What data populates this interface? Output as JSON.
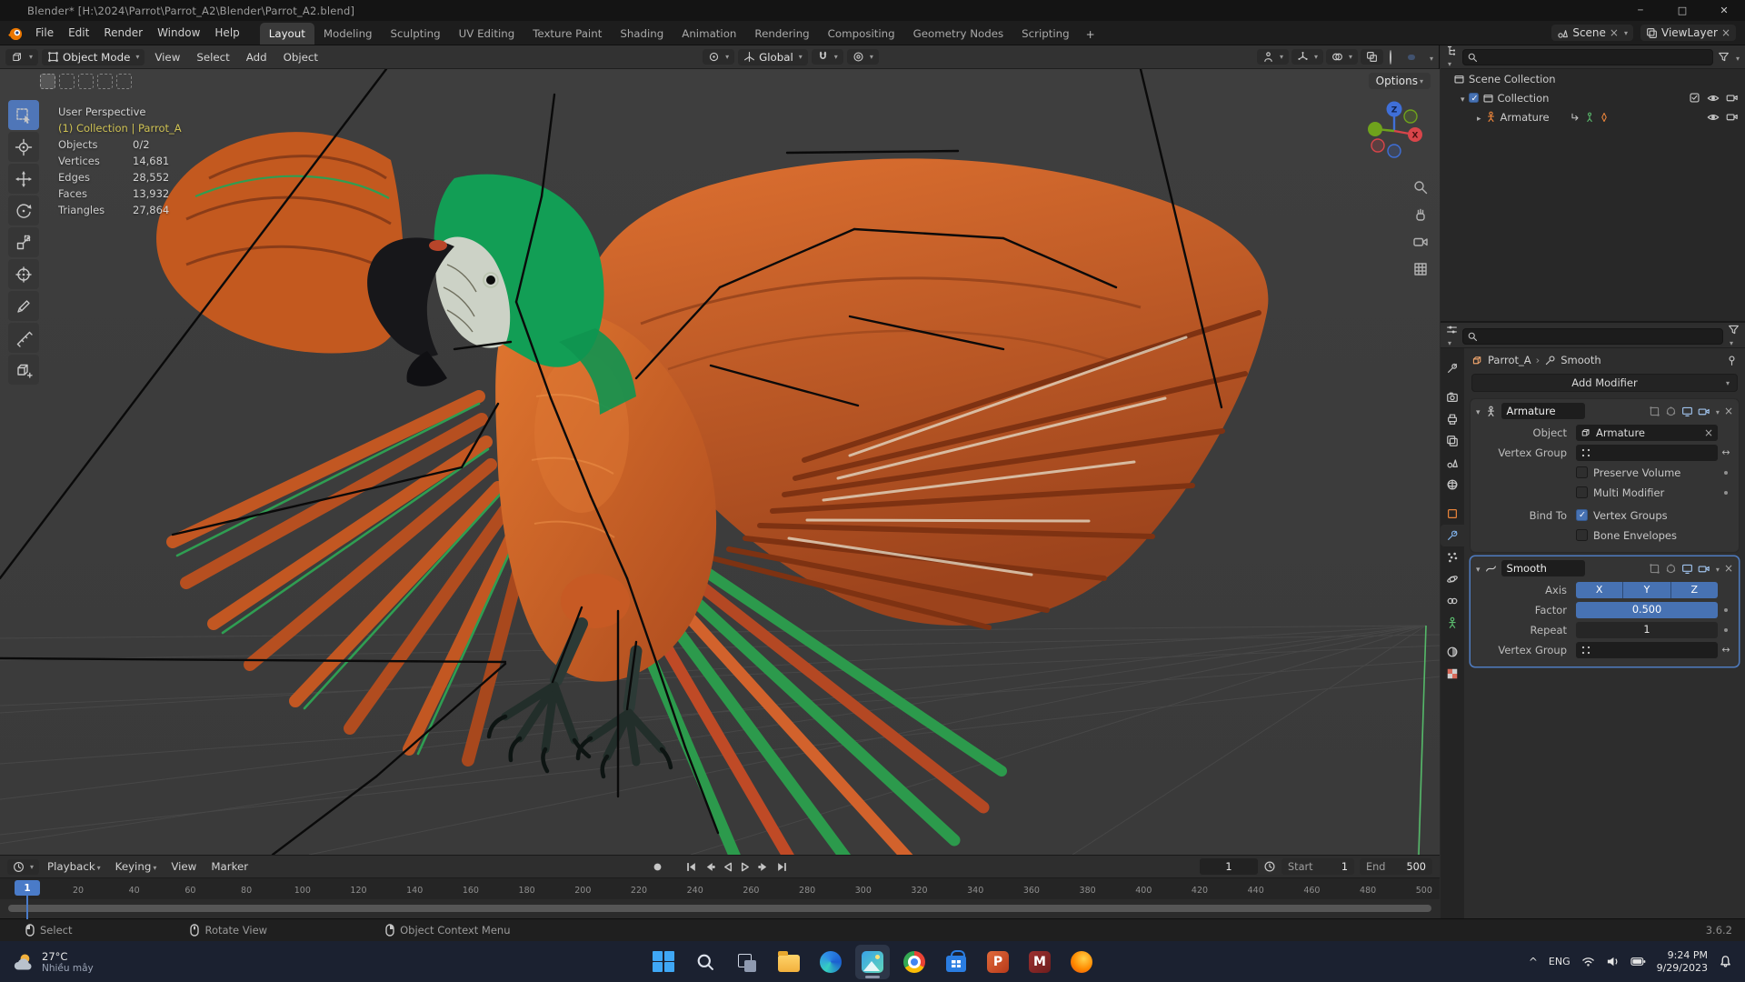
{
  "window": {
    "title": "Blender* [H:\\2024\\Parrot\\Parrot_A2\\Blender\\Parrot_A2.blend]"
  },
  "topbar": {
    "menus": {
      "file": "File",
      "edit": "Edit",
      "render": "Render",
      "window": "Window",
      "help": "Help"
    },
    "workspaces": [
      "Layout",
      "Modeling",
      "Sculpting",
      "UV Editing",
      "Texture Paint",
      "Shading",
      "Animation",
      "Rendering",
      "Compositing",
      "Geometry Nodes",
      "Scripting"
    ],
    "add_workspace_label": "+",
    "scene_name": "Scene",
    "view_layer_name": "ViewLayer"
  },
  "viewport": {
    "header": {
      "mode": "Object Mode",
      "view": "View",
      "select": "Select",
      "add": "Add",
      "object": "Object",
      "orientation": "Global"
    },
    "options_label": "Options",
    "overlay": {
      "perspective": "User Perspective",
      "context": "(1) Collection | Parrot_A",
      "stats": [
        {
          "label": "Objects",
          "value": "0/2"
        },
        {
          "label": "Vertices",
          "value": "14,681"
        },
        {
          "label": "Edges",
          "value": "28,552"
        },
        {
          "label": "Faces",
          "value": "13,932"
        },
        {
          "label": "Triangles",
          "value": "27,864"
        }
      ]
    }
  },
  "outliner": {
    "rows": [
      {
        "label": "Scene Collection"
      },
      {
        "label": "Collection"
      },
      {
        "label": "Armature"
      }
    ]
  },
  "properties": {
    "breadcrumb": {
      "object": "Parrot_A",
      "modifier": "Smooth"
    },
    "add_modifier_label": "Add Modifier",
    "armature": {
      "name": "Armature",
      "object_label": "Object",
      "object_value": "Armature",
      "vertex_group_label": "Vertex Group",
      "preserve_volume_label": "Preserve Volume",
      "multi_modifier_label": "Multi Modifier",
      "bind_to_label": "Bind To",
      "vertex_groups_label": "Vertex Groups",
      "bone_envelopes_label": "Bone Envelopes"
    },
    "smooth": {
      "name": "Smooth",
      "axis_label": "Axis",
      "axis_x": "X",
      "axis_y": "Y",
      "axis_z": "Z",
      "factor_label": "Factor",
      "factor_value": "0.500",
      "repeat_label": "Repeat",
      "repeat_value": "1",
      "vertex_group_label": "Vertex Group"
    }
  },
  "timeline": {
    "menus": {
      "playback": "Playback",
      "keying": "Keying",
      "view": "View",
      "marker": "Marker"
    },
    "current_frame": "1",
    "start_label": "Start",
    "start_value": "1",
    "end_label": "End",
    "end_value": "500",
    "ruler_marks": [
      20,
      40,
      60,
      80,
      100,
      120,
      140,
      160,
      180,
      200,
      220,
      240,
      260,
      280,
      300,
      320,
      340,
      360,
      380,
      400,
      420,
      440,
      460,
      480,
      500
    ]
  },
  "status_bar": {
    "select": "Select",
    "rotate_view": "Rotate View",
    "context_menu": "Object Context Menu",
    "version": "3.6.2"
  },
  "taskbar": {
    "weather_temp": "27°C",
    "weather_desc": "Nhiều mây",
    "tray_lang": "ENG",
    "time": "9:24 PM",
    "date": "9/29/2023"
  },
  "colors": {
    "accent": "#4772b3",
    "object_orange": "#e8833a",
    "data_green": "#59b86c"
  }
}
